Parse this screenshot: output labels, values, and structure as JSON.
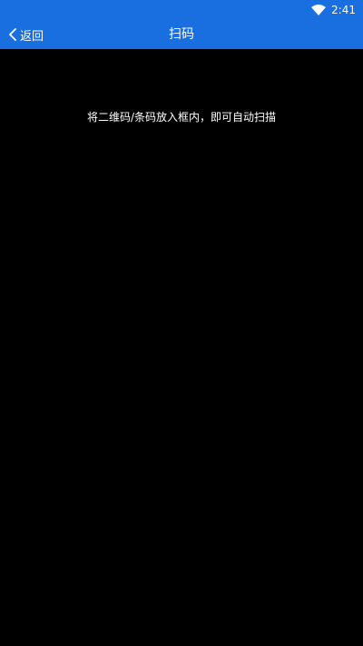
{
  "status_bar": {
    "time": "2:41",
    "icons": [
      "wifi-icon"
    ],
    "background": "#1a6fe0"
  },
  "app_bar": {
    "back_label": "返回",
    "title": "扫码",
    "background": "#1a6fe0"
  },
  "scanner": {
    "hint": "将二维码/条码放入框内，即可自动扫描",
    "background": "#000000"
  }
}
